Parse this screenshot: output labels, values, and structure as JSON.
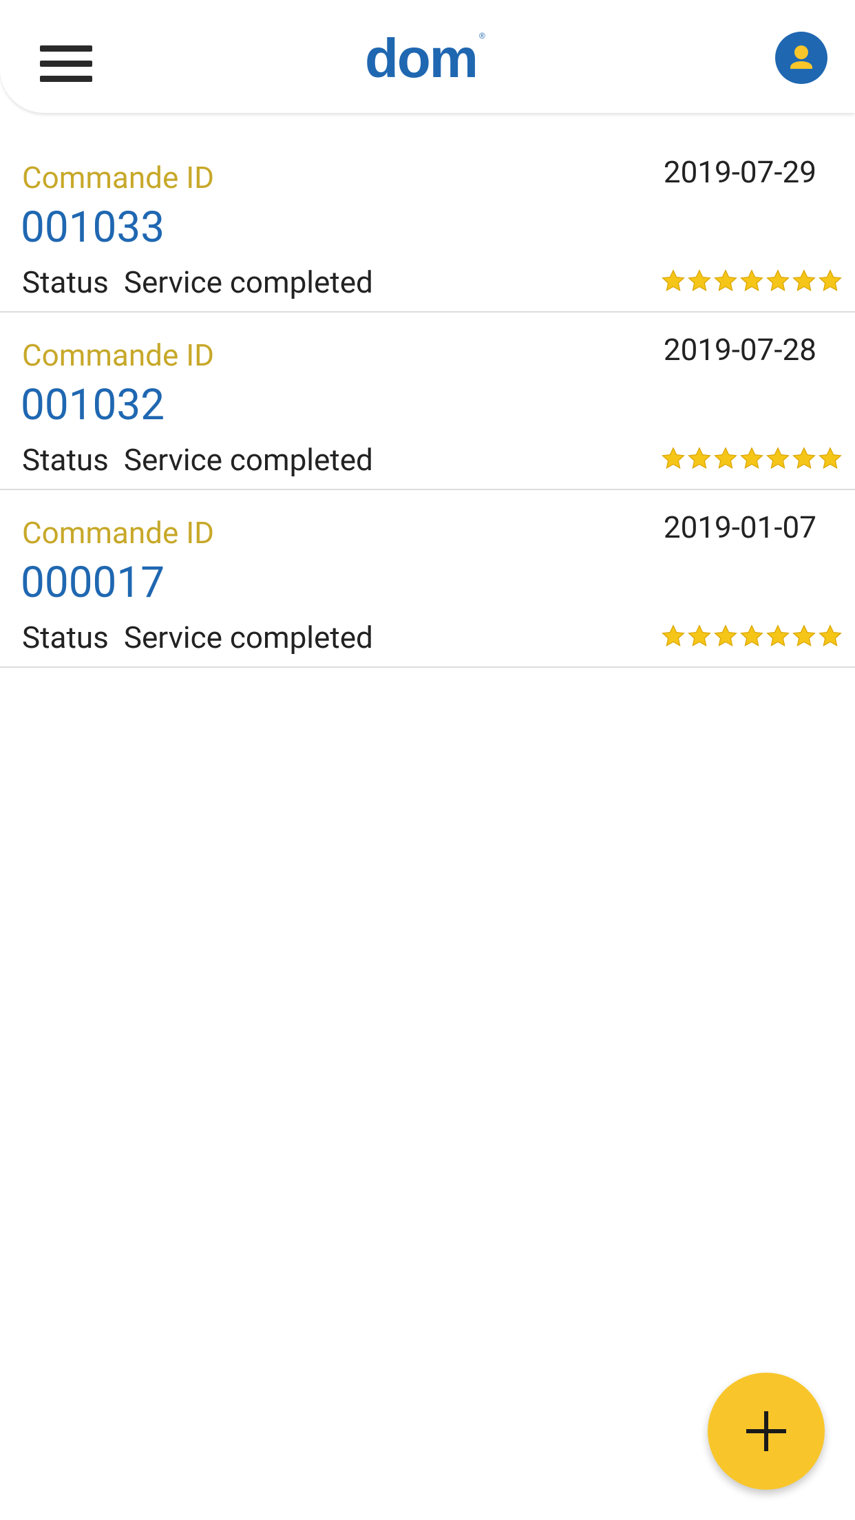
{
  "app": {
    "logo_text": "dom",
    "logo_mark": "®",
    "brand_color": "#1f67b1",
    "accent_color": "#c7a829",
    "fab_color": "#f8c62a"
  },
  "header": {
    "menu_icon": "hamburger-menu-icon",
    "profile_icon": "user-avatar-icon"
  },
  "orders": [
    {
      "label": "Commande ID",
      "id": "001033",
      "date": "2019-07-29",
      "status_label": "Status",
      "status": "Service completed",
      "rating": 7,
      "rating_max": 7
    },
    {
      "label": "Commande ID",
      "id": "001032",
      "date": "2019-07-28",
      "status_label": "Status",
      "status": "Service completed",
      "rating": 7,
      "rating_max": 7
    },
    {
      "label": "Commande ID",
      "id": "000017",
      "date": "2019-01-07",
      "status_label": "Status",
      "status": "Service completed",
      "rating": 7,
      "rating_max": 7
    }
  ],
  "fab": {
    "icon": "plus-icon"
  }
}
